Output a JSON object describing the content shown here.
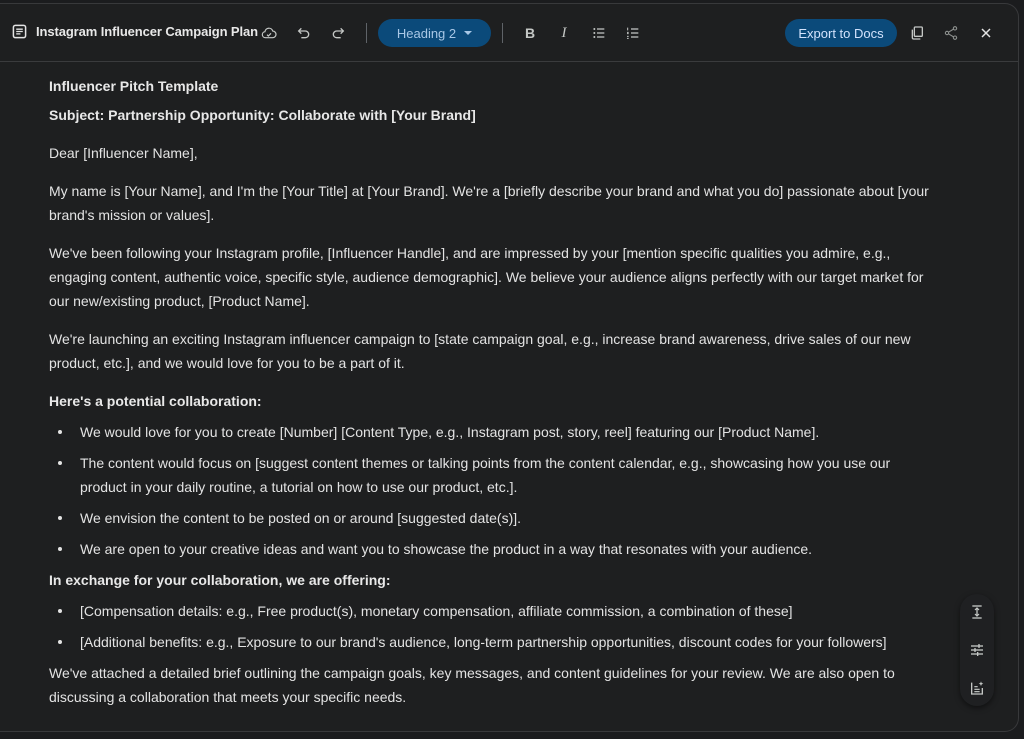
{
  "toolbar": {
    "doc_title": "Instagram Influencer Campaign Plan",
    "icons": {
      "doc": "document-icon",
      "cloud": "cloud-saved-icon",
      "undo": "undo-icon",
      "redo": "redo-icon",
      "bold": "bold-icon",
      "italic": "italic-icon",
      "bulleted_list": "bulleted-list-icon",
      "numbered_list": "numbered-list-icon",
      "copy": "copy-icon",
      "share": "share-icon",
      "close": "close-icon"
    },
    "heading_style": "Heading 2",
    "bold_label": "B",
    "italic_label": "I",
    "export_label": "Export to Docs"
  },
  "document": {
    "title": "Influencer Pitch Template",
    "subject": "Subject: Partnership Opportunity: Collaborate with [Your Brand]",
    "greeting": "Dear [Influencer Name],",
    "paragraphs": [
      "My name is [Your Name], and I'm the [Your Title] at [Your Brand]. We're a [briefly describe your brand and what you do] passionate about [your brand's mission or values].",
      "We've been following your Instagram profile, [Influencer Handle], and are impressed by your [mention specific qualities you admire, e.g., engaging content, authentic voice, specific style, audience demographic]. We believe your audience aligns perfectly with our target market for our new/existing product, [Product Name].",
      "We're launching an exciting Instagram influencer campaign to [state campaign goal, e.g., increase brand awareness, drive sales of our new product, etc.], and we would love for you to be a part of it."
    ],
    "collab_heading": "Here's a potential collaboration:",
    "collab_items": [
      "We would love for you to create [Number] [Content Type, e.g., Instagram post, story, reel] featuring our [Product Name].",
      "The content would focus on [suggest content themes or talking points from the content calendar, e.g., showcasing how you use our product in your daily routine, a tutorial on how to use our product, etc.].",
      "We envision the content to be posted on or around [suggested date(s)].",
      "We are open to your creative ideas and want you to showcase the product in a way that resonates with your audience."
    ],
    "offer_heading": "In exchange for your collaboration, we are offering:",
    "offer_items": [
      "[Compensation details: e.g., Free product(s), monetary compensation, affiliate commission, a combination of these]",
      "[Additional benefits: e.g., Exposure to our brand's audience, long-term partnership opportunities, discount codes for your followers]"
    ],
    "closing": "We've attached a detailed brief outlining the campaign goals, key messages, and content guidelines for your review. We are also open to discussing a collaboration that meets your specific needs."
  },
  "side_tools": {
    "icons": [
      "adjust-length-icon",
      "tune-settings-icon",
      "edit-with-ai-icon"
    ]
  },
  "colors": {
    "accent_button_bg": "#0b4a7a",
    "accent_button_text": "#d3e3fd",
    "background": "#1e1f20",
    "text": "#e3e3e3"
  }
}
